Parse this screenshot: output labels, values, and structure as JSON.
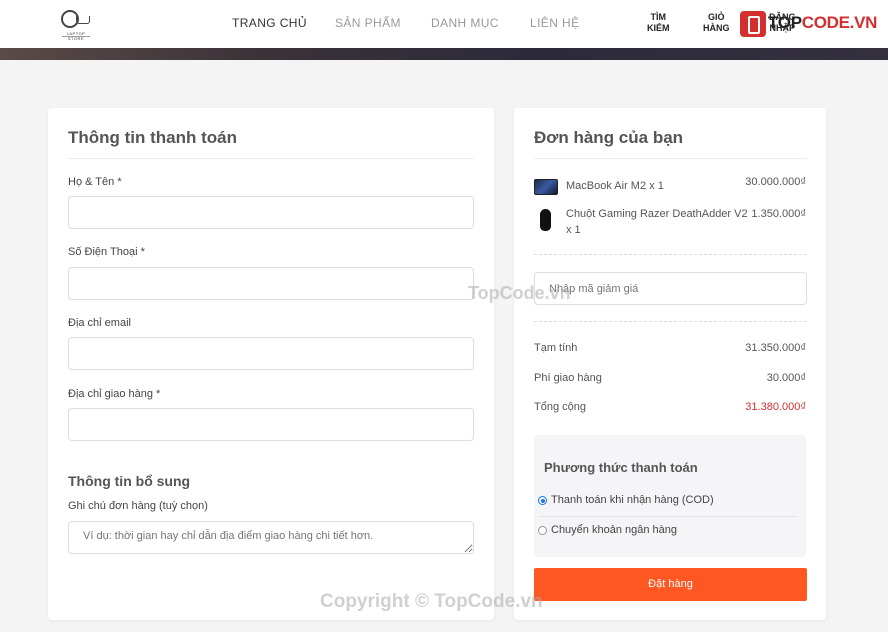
{
  "header": {
    "logo_text": "LAPTOP STORE",
    "nav": [
      "TRANG CHỦ",
      "SẢN PHẨM",
      "DANH MỤC",
      "LIÊN HỆ"
    ],
    "search": {
      "line1": "TÌM",
      "line2": "KIẾM"
    },
    "cart": {
      "line1": "GIỎ",
      "line2": "HÀNG"
    },
    "login": {
      "line1": "ĐĂNG",
      "line2": "NHẬP"
    },
    "brand": {
      "prefix": "TOP",
      "suffix": "CODE.VN"
    }
  },
  "billing": {
    "title": "Thông tin thanh toán",
    "fields": [
      {
        "label": "Họ & Tên *",
        "value": ""
      },
      {
        "label": "Số Điện Thoại *",
        "value": ""
      },
      {
        "label": "Địa chỉ email",
        "value": ""
      },
      {
        "label": "Địa chỉ giao hàng *",
        "value": ""
      }
    ],
    "extra_title": "Thông tin bổ sung",
    "note_label": "Ghi chú đơn hàng (tuỳ chọn)",
    "note_placeholder": "Ví dụ: thời gian hay chỉ dẫn địa điểm giao hàng chi tiết hơn."
  },
  "order": {
    "title": "Đơn hàng của bạn",
    "items": [
      {
        "name": "MacBook Air M2 x 1",
        "price": "30.000.000₫",
        "icon": "laptop-thumbnail"
      },
      {
        "name": "Chuột Gaming Razer DeathAdder V2 x 1",
        "price": "1.350.000₫",
        "icon": "mouse-thumbnail"
      }
    ],
    "coupon_placeholder": "Nhập mã giảm giá",
    "subtotal_label": "Tạm tính",
    "subtotal": "31.350.000₫",
    "shipping_label": "Phí giao hàng",
    "shipping": "30.000₫",
    "total_label": "Tổng cộng",
    "total": "31.380.000₫",
    "payment": {
      "title": "Phương thức thanh toán",
      "options": [
        {
          "label": "Thanh toán khi nhận hàng (COD)",
          "selected": true
        },
        {
          "label": "Chuyển khoản ngân hàng",
          "selected": false
        }
      ]
    },
    "submit_label": "Đặt hàng"
  },
  "watermarks": {
    "center": "TopCode.vn",
    "footer": "Copyright © TopCode.vn"
  },
  "colors": {
    "accent": "#ff5722",
    "total": "#d32f2f",
    "radio": "#1a73e8"
  }
}
